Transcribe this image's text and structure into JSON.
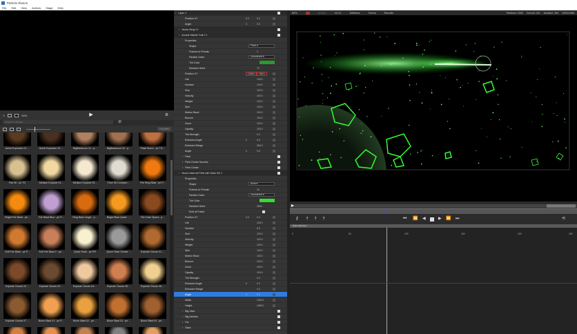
{
  "window": {
    "title": "Particle Illusion"
  },
  "menu": [
    "File",
    "Edit",
    "View",
    "Actions",
    "Stage",
    "Help"
  ],
  "library": {
    "zoom": "50%",
    "search_placeholder": "Search Library",
    "favorites_label": "Favorites",
    "items": [
      {
        "name": "Aerial Explosion 01 ...",
        "color": "#5a3a20"
      },
      {
        "name": "Aerial Explosion 02 ...",
        "color": "#4a3020"
      },
      {
        "name": "BigBalaboom 01 : p...",
        "color": "#b08060"
      },
      {
        "name": "BigBalaboom 02 : p...",
        "color": "#a07050"
      },
      {
        "name": "Flash Boom : pe TG...",
        "color": "#c07040"
      },
      {
        "name": "Flat Hit : pe TG",
        "color": "#d8c090"
      },
      {
        "name": "Medium Explode 01...",
        "color": "#f0d8a0"
      },
      {
        "name": "Medium Explode 02...",
        "color": "#f5e8d0"
      },
      {
        "name": "Floor Hit Complex ...",
        "color": "#e0dcd0"
      },
      {
        "name": "Fire Ring Blast : pe P...",
        "color": "#f07a10"
      },
      {
        "name": "Bright Fire Blast : pe...",
        "color": "#f58a10"
      },
      {
        "name": "Fire Blast Blue : pe P...",
        "color": "#c0a0d0"
      },
      {
        "name": "Ring Blast Linger : p...",
        "color": "#d86a10"
      },
      {
        "name": "Bright Blast Quick : ...",
        "color": "#f59a20"
      },
      {
        "name": "Fire Gate Opens : p...",
        "color": "#8a4a20"
      },
      {
        "name": "Soft Fire Blast : pe P...",
        "color": "#d07a30"
      },
      {
        "name": "Soft Fire Blast 2 : pe...",
        "color": "#c8805a"
      },
      {
        "name": "Quick Flash : pe PR",
        "color": "#f8f0d0"
      },
      {
        "name": "Quick Flash Smoke ...",
        "color": "#9a9a9a"
      },
      {
        "name": "Explode Clouds 01 ...",
        "color": "#b06a30"
      },
      {
        "name": "Explode Clouds 02 ...",
        "color": "#7a4a2a"
      },
      {
        "name": "Explode Clouds 03 ...",
        "color": "#6a4a30"
      },
      {
        "name": "Explode Clouds 04 ...",
        "color": "#f0c8a0"
      },
      {
        "name": "Explode Clouds 05 ...",
        "color": "#d08050"
      },
      {
        "name": "Explode Clouds 06 ...",
        "color": "#f0d090"
      },
      {
        "name": "Explode Clouds 07 ...",
        "color": "#8a5a30"
      },
      {
        "name": "Boom Blast 01 : pe P...",
        "color": "#f0a050"
      },
      {
        "name": "Boom Blast 02 : pe ...",
        "color": "#e8a040"
      },
      {
        "name": "Boom Blast 03 : pe ...",
        "color": "#c07030"
      },
      {
        "name": "Boom Blast 04 : pe ...",
        "color": "#a06030"
      },
      {
        "name": "",
        "color": "#d08040"
      },
      {
        "name": "",
        "color": "#e09050"
      },
      {
        "name": "",
        "color": "#c08050"
      },
      {
        "name": "",
        "color": "#808080"
      },
      {
        "name": "",
        "color": "#e0a060"
      }
    ]
  },
  "properties": [
    {
      "label": "Layer 1",
      "type": "group",
      "indent": 0
    },
    {
      "label": "Position XY",
      "v1": "0.0",
      "v2": "0.0",
      "indent": 2
    },
    {
      "label": "Angle",
      "v1": "0",
      "v2": "0.0",
      "indent": 2
    },
    {
      "label": "Vector Berg V1",
      "type": "group",
      "indent": 1
    },
    {
      "label": "Arcade Missile Trail 2 1",
      "type": "group",
      "indent": 1
    },
    {
      "label": "Properties",
      "indent": 2
    },
    {
      "label": "Shape",
      "dd": "Point",
      "indent": 3
    },
    {
      "label": "Frames to Precalc",
      "v2": "0",
      "indent": 3
    },
    {
      "label": "Particle Order",
      "dd": "Unordered",
      "indent": 3
    },
    {
      "label": "Tint Color",
      "color": "#2a9a2a",
      "indent": 3
    },
    {
      "label": "Random Seed",
      "v2": "70",
      "indent": 3
    },
    {
      "label": "Position XY",
      "v1": "1366.0",
      "v2": "188.0",
      "red": true,
      "indent": 2
    },
    {
      "label": "Life",
      "v2": "100.0",
      "indent": 2
    },
    {
      "label": "Number",
      "v2": "100.0",
      "indent": 2
    },
    {
      "label": "Size",
      "v2": "100.0",
      "indent": 2
    },
    {
      "label": "Velocity",
      "v2": "100.0",
      "indent": 2
    },
    {
      "label": "Weight",
      "v2": "100.0",
      "indent": 2
    },
    {
      "label": "Spin",
      "v2": "100.0",
      "indent": 2
    },
    {
      "label": "Motion Rand",
      "v2": "100.0",
      "indent": 2
    },
    {
      "label": "Bounce",
      "v2": "100.0",
      "indent": 2
    },
    {
      "label": "Zoom",
      "v2": "100.0",
      "indent": 2
    },
    {
      "label": "Opacity",
      "v2": "100.0",
      "indent": 2
    },
    {
      "label": "Tint Strength",
      "v2": "0.0",
      "indent": 2
    },
    {
      "label": "Emission Angle",
      "v1": "0",
      "v2": "0.0",
      "indent": 2
    },
    {
      "label": "Emission Range",
      "v2": "360.0",
      "indent": 2
    },
    {
      "label": "Angle",
      "v1": "0",
      "v2": "0.0",
      "indent": 2
    },
    {
      "label": "Pixel",
      "type": "sub",
      "indent": 2
    },
    {
      "label": "Pixel Center Nozzles",
      "type": "sub",
      "indent": 2
    },
    {
      "label": "Pixel Center",
      "type": "sub",
      "indent": 2
    },
    {
      "label": "Vector Asteroid Field with Stars HD 1",
      "type": "group",
      "indent": 1
    },
    {
      "label": "Properties",
      "indent": 2
    },
    {
      "label": "Shape",
      "dd": "Area",
      "indent": 3
    },
    {
      "label": "Frames to Precalc",
      "v2": "30",
      "indent": 3
    },
    {
      "label": "Particle Order",
      "dd": "Unordered",
      "indent": 3
    },
    {
      "label": "Tint Color",
      "color": "#2fdf2f",
      "indent": 3
    },
    {
      "label": "Random Seed",
      "v2": "3600",
      "indent": 3
    },
    {
      "label": "Emit at Points",
      "check": true,
      "indent": 3
    },
    {
      "label": "Position XY",
      "v1": "0.0",
      "v2": "0.0",
      "indent": 2
    },
    {
      "label": "Life",
      "v2": "100.0",
      "indent": 2
    },
    {
      "label": "Number",
      "v2": "5.0",
      "indent": 2
    },
    {
      "label": "Size",
      "v2": "100.0",
      "indent": 2
    },
    {
      "label": "Velocity",
      "v2": "100.0",
      "indent": 2
    },
    {
      "label": "Weight",
      "v2": "100.0",
      "indent": 2
    },
    {
      "label": "Spin",
      "v2": "100.0",
      "indent": 2
    },
    {
      "label": "Motion Rand",
      "v2": "100.0",
      "indent": 2
    },
    {
      "label": "Bounce",
      "v2": "100.0",
      "indent": 2
    },
    {
      "label": "Zoom",
      "v2": "100.0",
      "indent": 2
    },
    {
      "label": "Opacity",
      "v2": "100.0",
      "indent": 2
    },
    {
      "label": "Tint Strength",
      "v2": "0.0",
      "indent": 2
    },
    {
      "label": "Emission Angle",
      "v1": "0",
      "v2": "0.0",
      "indent": 2
    },
    {
      "label": "Emission Range",
      "v2": "0.0",
      "indent": 2
    },
    {
      "label": "Angle",
      "v1": "0",
      "v2": "0.0",
      "type": "sel",
      "indent": 2
    },
    {
      "label": "Width",
      "v2": "1920.0",
      "indent": 2
    },
    {
      "label": "Height",
      "v2": "1080.0",
      "indent": 2
    },
    {
      "label": "Big Vase",
      "type": "sub",
      "indent": 2
    },
    {
      "label": "Big Infinites",
      "type": "sub",
      "indent": 2
    },
    {
      "label": "Far",
      "type": "sub",
      "indent": 2
    },
    {
      "label": "Stars",
      "type": "sub",
      "indent": 2
    }
  ],
  "viewer": {
    "zoom": "82%",
    "tools": [
      "Ai Mon",
      "VLCC",
      "Deflector",
      "Forms",
      "Reorder"
    ],
    "status": [
      "Particles: 2335",
      "Current: 161",
      "Duration: 300",
      "1920x1080"
    ]
  },
  "timeline": {
    "track": "Scan Harmed 1",
    "ticks": [
      "0",
      "50",
      "100",
      "150",
      "200",
      "250"
    ]
  },
  "colors": {
    "accent": "#2f7de0",
    "green": "#39ff39"
  }
}
